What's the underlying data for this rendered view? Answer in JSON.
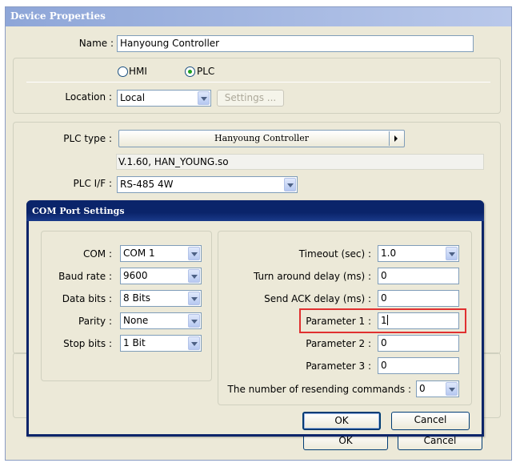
{
  "device_properties": {
    "title": "Device Properties",
    "name_label": "Name :",
    "name_value": "Hanyoung Controller",
    "radio_hmi": "HMI",
    "radio_plc": "PLC",
    "location_label": "Location :",
    "location_value": "Local",
    "settings_button": "Settings ...",
    "plc_type_label": "PLC type :",
    "plc_type_value": "Hanyoung Controller",
    "driver_info": "V.1.60, HAN_YOUNG.so",
    "plc_if_label": "PLC I/F :",
    "plc_if_value": "RS-485 4W",
    "ok_label": "OK",
    "cancel_label": "Cancel"
  },
  "com_port_settings": {
    "title": "COM Port Settings",
    "com_label": "COM :",
    "com_value": "COM 1",
    "baud_label": "Baud rate :",
    "baud_value": "9600",
    "data_bits_label": "Data bits :",
    "data_bits_value": "8 Bits",
    "parity_label": "Parity :",
    "parity_value": "None",
    "stop_bits_label": "Stop bits :",
    "stop_bits_value": "1 Bit",
    "timeout_label": "Timeout (sec) :",
    "timeout_value": "1.0",
    "turnaround_label": "Turn around delay (ms) :",
    "turnaround_value": "0",
    "ack_label": "Send ACK delay (ms) :",
    "ack_value": "0",
    "param1_label": "Parameter 1 :",
    "param1_value": "1",
    "param2_label": "Parameter 2 :",
    "param2_value": "0",
    "param3_label": "Parameter 3 :",
    "param3_value": "0",
    "resend_label": "The number of resending commands :",
    "resend_value": "0",
    "ok_label": "OK",
    "cancel_label": "Cancel"
  },
  "colors": {
    "title_bar": "#0a246a",
    "title_bar_inactive": "#7a96df",
    "dialog_bg": "#ece9d8",
    "highlight_box": "#e03030"
  }
}
